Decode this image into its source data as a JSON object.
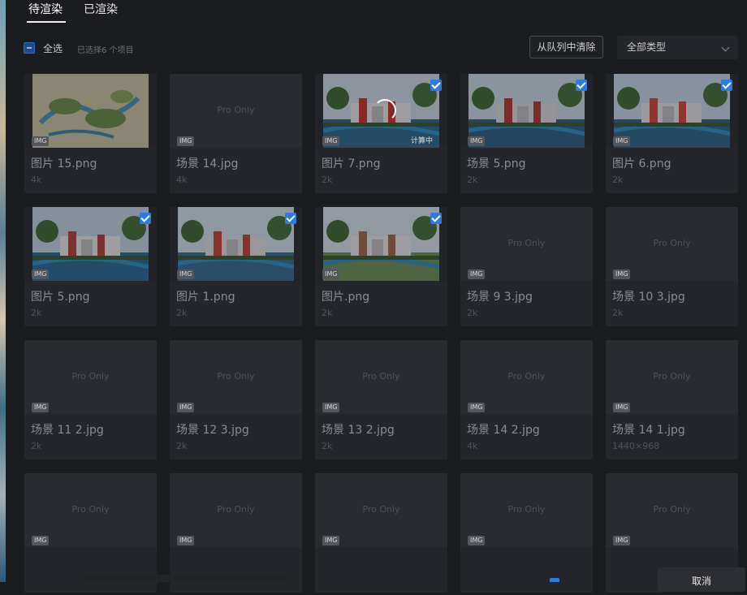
{
  "tabs": {
    "pending": "待渲染",
    "rendered": "已渲染"
  },
  "toolbar": {
    "select_all": "全选",
    "selected_info": "已选择6 个项目",
    "clear_button": "从队列中清除",
    "type_filter": "全部类型"
  },
  "labels": {
    "pro_only": "Pro Only",
    "img_tag": "IMG",
    "computing": "计算中"
  },
  "cards": [
    {
      "name": "图片 15.png",
      "size": "4k",
      "thumb": "map",
      "checked": false
    },
    {
      "name": "场景 14.jpg",
      "size": "4k",
      "thumb": "pro",
      "checked": false
    },
    {
      "name": "图片 7.png",
      "size": "2k",
      "thumb": "scene-a",
      "checked": true,
      "computing": true
    },
    {
      "name": "场景 5.png",
      "size": "2k",
      "thumb": "scene-b",
      "checked": true
    },
    {
      "name": "图片 6.png",
      "size": "2k",
      "thumb": "scene-c",
      "checked": true
    },
    {
      "name": "图片 5.png",
      "size": "2k",
      "thumb": "scene-d",
      "checked": true
    },
    {
      "name": "图片 1.png",
      "size": "2k",
      "thumb": "scene-e",
      "checked": true
    },
    {
      "name": "图片.png",
      "size": "2k",
      "thumb": "scene-f",
      "checked": true
    },
    {
      "name": "场景 9 3.jpg",
      "size": "2k",
      "thumb": "pro",
      "checked": false
    },
    {
      "name": "场景 10 3.jpg",
      "size": "2k",
      "thumb": "pro",
      "checked": false
    },
    {
      "name": "场景 11 2.jpg",
      "size": "2k",
      "thumb": "pro",
      "checked": false
    },
    {
      "name": "场景 12 3.jpg",
      "size": "2k",
      "thumb": "pro",
      "checked": false
    },
    {
      "name": "场景 13 2.jpg",
      "size": "2k",
      "thumb": "pro",
      "checked": false
    },
    {
      "name": "场景 14 2.jpg",
      "size": "4k",
      "thumb": "pro",
      "checked": false
    },
    {
      "name": "场景 14 1.jpg",
      "size": "1440×968",
      "thumb": "pro",
      "checked": false
    },
    {
      "name": "",
      "size": "",
      "thumb": "pro",
      "checked": false
    },
    {
      "name": "",
      "size": "",
      "thumb": "pro",
      "checked": false
    },
    {
      "name": "",
      "size": "",
      "thumb": "pro",
      "checked": false
    },
    {
      "name": "",
      "size": "",
      "thumb": "pro",
      "checked": false
    },
    {
      "name": "",
      "size": "",
      "thumb": "pro",
      "checked": false
    }
  ],
  "footer": {
    "cancel_button": "取消"
  },
  "colors": {
    "accent": "#2c7be5",
    "background": "#1b1c20",
    "card": "#25262b"
  }
}
